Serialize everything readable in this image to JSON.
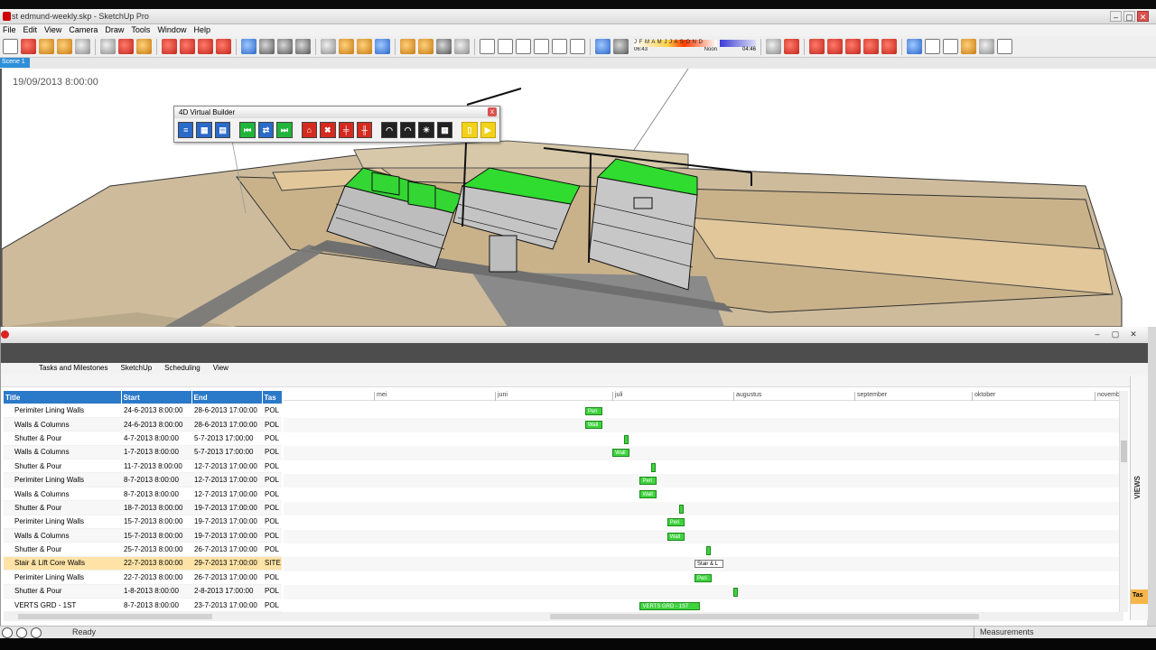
{
  "window": {
    "title": "st edmund-weekly.skp - SketchUp Pro",
    "controls": [
      "–",
      "▢",
      "✕"
    ]
  },
  "menu": [
    "File",
    "Edit",
    "View",
    "Camera",
    "Draw",
    "Tools",
    "Window",
    "Help"
  ],
  "shadow": {
    "months": "J F M A M J J A S O N D",
    "time_start": "06:43",
    "time_mid": "Noon",
    "time_end": "04:46"
  },
  "scene_tab": "Scene 1",
  "viewport": {
    "datetime": "19/09/2013 8:00:00"
  },
  "virtual_builder": {
    "title": "4D Virtual Builder",
    "close": "x"
  },
  "scheduler": {
    "controls": [
      "–",
      "▢",
      "✕"
    ],
    "ribbon_tabs": [
      "Tasks and Milestones",
      "SketchUp",
      "Scheduling",
      "View"
    ],
    "columns": [
      "Title",
      "Start",
      "End",
      "Tas"
    ],
    "rows": [
      {
        "title": "Perimiter Lining Walls",
        "start": "24-6-2013 8:00:00",
        "end": "28-6-2013 17:00:00",
        "tas": "POL"
      },
      {
        "title": "Walls & Columns",
        "start": "24-6-2013 8:00:00",
        "end": "28-6-2013 17:00:00",
        "tas": "POL"
      },
      {
        "title": "Shutter & Pour",
        "start": "4-7-2013 8:00:00",
        "end": "5-7-2013 17:00:00",
        "tas": "POL"
      },
      {
        "title": "Walls & Columns",
        "start": "1-7-2013 8:00:00",
        "end": "5-7-2013 17:00:00",
        "tas": "POL"
      },
      {
        "title": "Shutter & Pour",
        "start": "11-7-2013 8:00:00",
        "end": "12-7-2013 17:00:00",
        "tas": "POL"
      },
      {
        "title": "Perimiter Lining Walls",
        "start": "8-7-2013 8:00:00",
        "end": "12-7-2013 17:00:00",
        "tas": "POL"
      },
      {
        "title": "Walls & Columns",
        "start": "8-7-2013 8:00:00",
        "end": "12-7-2013 17:00:00",
        "tas": "POL"
      },
      {
        "title": "Shutter & Pour",
        "start": "18-7-2013 8:00:00",
        "end": "19-7-2013 17:00:00",
        "tas": "POL"
      },
      {
        "title": "Perimiter Lining Walls",
        "start": "15-7-2013 8:00:00",
        "end": "19-7-2013 17:00:00",
        "tas": "POL"
      },
      {
        "title": "Walls & Columns",
        "start": "15-7-2013 8:00:00",
        "end": "19-7-2013 17:00:00",
        "tas": "POL"
      },
      {
        "title": "Shutter & Pour",
        "start": "25-7-2013 8:00:00",
        "end": "26-7-2013 17:00:00",
        "tas": "POL"
      },
      {
        "title": "Stair & Lift Core Walls",
        "start": "22-7-2013 8:00:00",
        "end": "29-7-2013 17:00:00",
        "tas": "SITE"
      },
      {
        "title": "Perimiter Lining Walls",
        "start": "22-7-2013 8:00:00",
        "end": "26-7-2013 17:00:00",
        "tas": "POL"
      },
      {
        "title": "Shutter & Pour",
        "start": "1-8-2013 8:00:00",
        "end": "2-8-2013 17:00:00",
        "tas": "POL"
      },
      {
        "title": "VERTS GRD - 1ST",
        "start": "8-7-2013 8:00:00",
        "end": "23-7-2013 17:00:00",
        "tas": "POL"
      }
    ],
    "months": [
      "mei",
      "juni",
      "juli",
      "augustus",
      "september",
      "oktober",
      "novemb"
    ],
    "bar_labels": {
      "perim": "Peri",
      "walls": "Wall",
      "stair": "Stair & L",
      "verts": "VERTS GRD - 1ST"
    },
    "views_label": "VIEWS",
    "tas_tab": "Tas"
  },
  "status": {
    "text": "Ready",
    "measurements": "Measurements"
  }
}
